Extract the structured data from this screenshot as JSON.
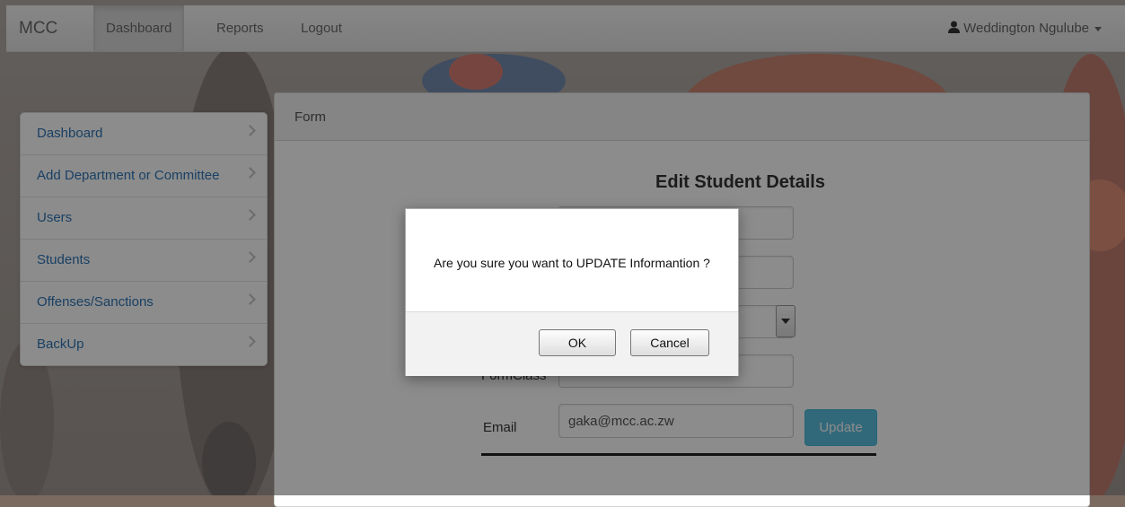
{
  "navbar": {
    "brand": "MCC",
    "items": [
      {
        "label": "Dashboard",
        "active": true
      },
      {
        "label": "Reports",
        "active": false
      },
      {
        "label": "Logout",
        "active": false
      }
    ],
    "user": {
      "name": "Weddington Ngulube",
      "icon": "user-icon"
    }
  },
  "sidebar": {
    "items": [
      {
        "label": "Dashboard"
      },
      {
        "label": "Add Department or Committee"
      },
      {
        "label": "Users"
      },
      {
        "label": "Students"
      },
      {
        "label": "Offenses/Sanctions"
      },
      {
        "label": "BackUp"
      }
    ]
  },
  "form": {
    "breadcrumb": "Form",
    "title": "Edit Student Details",
    "formclass_label": "FormClass",
    "email_label": "Email",
    "email_value": "gaka@mcc.ac.zw",
    "update_label": "Update"
  },
  "dialog": {
    "message": "Are you sure you want to UPDATE  Informantion ?",
    "ok_label": "OK",
    "cancel_label": "Cancel"
  },
  "colors": {
    "link": "#2f76b6",
    "info_button": "#5bc0de"
  }
}
